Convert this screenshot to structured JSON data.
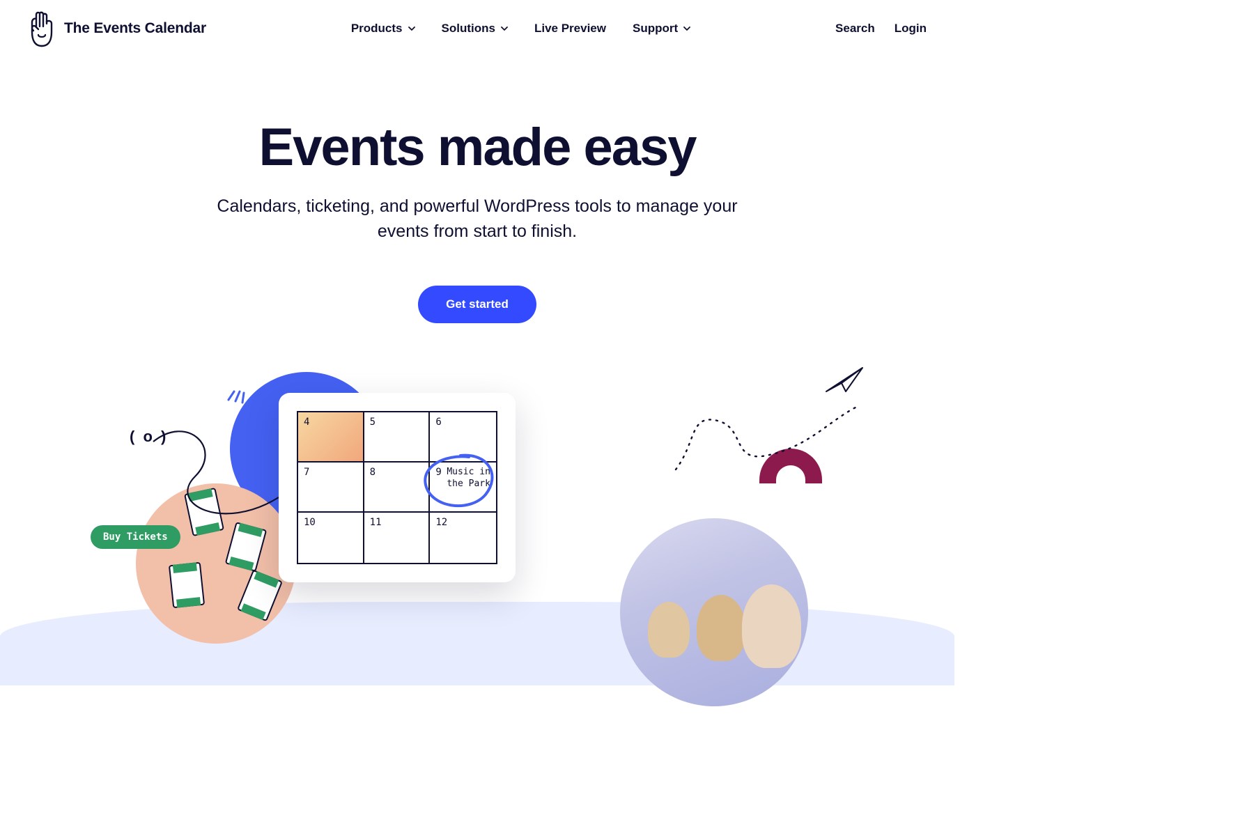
{
  "brand": {
    "name": "The Events Calendar"
  },
  "nav": {
    "items": [
      {
        "label": "Products",
        "has_chevron": true
      },
      {
        "label": "Solutions",
        "has_chevron": true
      },
      {
        "label": "Live Preview",
        "has_chevron": false
      },
      {
        "label": "Support",
        "has_chevron": true
      }
    ],
    "search": "Search",
    "login": "Login"
  },
  "hero": {
    "title": "Events made easy",
    "subtitle": "Calendars, ticketing, and powerful WordPress tools to manage your events from start to finish.",
    "cta": "Get started"
  },
  "illustration": {
    "buy_label": "Buy Tickets",
    "broadcast_glyph": "( o )",
    "calendar": {
      "days": [
        "4",
        "5",
        "6",
        "7",
        "8",
        "9",
        "10",
        "11",
        "12"
      ],
      "event_day_index": 5,
      "event_text": "Music in the Park"
    }
  }
}
